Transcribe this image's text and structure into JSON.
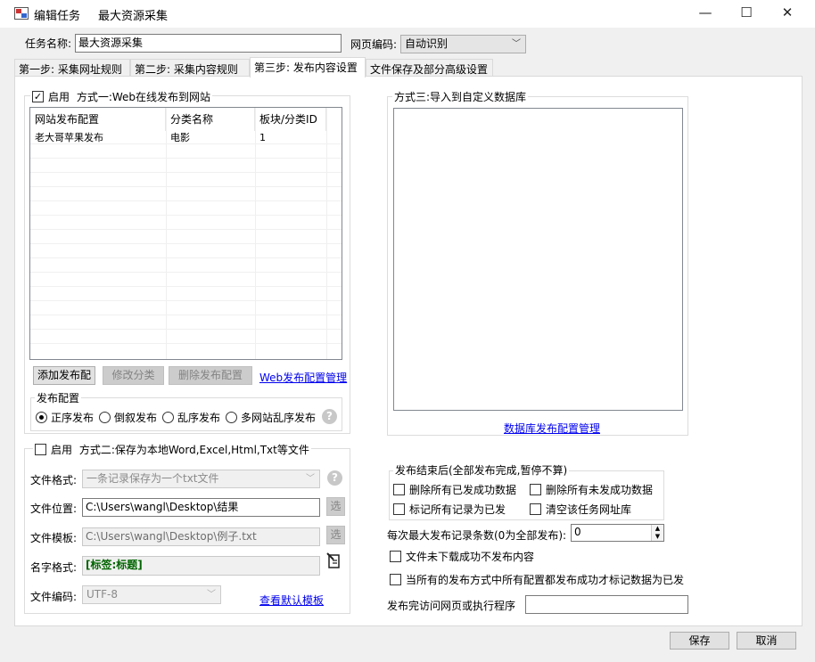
{
  "window": {
    "title": "编辑任务",
    "subtitle": "最大资源采集",
    "min_label": "—",
    "max_label": "☐",
    "close_label": "✕"
  },
  "header": {
    "task_name_label": "任务名称:",
    "task_name_value": "最大资源采集",
    "encoding_label": "网页编码:",
    "encoding_value": "自动识别"
  },
  "tabs": [
    {
      "label": "第一步: 采集网址规则"
    },
    {
      "label": "第二步: 采集内容规则"
    },
    {
      "label": "第三步: 发布内容设置"
    },
    {
      "label": "文件保存及部分高级设置"
    }
  ],
  "method1": {
    "enable_label": "启用",
    "title": "方式一:Web在线发布到网站",
    "checked": true,
    "columns": [
      "网站发布配置",
      "分类名称",
      "板块/分类ID"
    ],
    "rows": [
      [
        "老大哥苹果发布",
        "电影",
        "1"
      ]
    ],
    "add_button": "添加发布配",
    "edit_button": "修改分类",
    "delete_button": "删除发布配置",
    "manage_link": "Web发布配置管理",
    "publish_config_title": "发布配置",
    "order_options": [
      "正序发布",
      "倒叙发布",
      "乱序发布",
      "多网站乱序发布"
    ],
    "order_selected": "正序发布"
  },
  "method2": {
    "enable_label": "启用",
    "title": "方式二:保存为本地Word,Excel,Html,Txt等文件",
    "checked": false,
    "format_label": "文件格式:",
    "format_value": "一条记录保存为一个txt文件",
    "location_label": "文件位置:",
    "location_value": "C:\\Users\\wangl\\Desktop\\结果",
    "choose_label": "选",
    "template_label": "文件模板:",
    "template_value": "C:\\Users\\wangl\\Desktop\\例子.txt",
    "name_label": "名字格式:",
    "name_value": "[标签:标题]",
    "encoding_label": "文件编码:",
    "encoding_value": "UTF-8",
    "view_template_link": "查看默认模板"
  },
  "method3": {
    "title": "方式三:导入到自定义数据库",
    "manage_link": "数据库发布配置管理"
  },
  "after_publish": {
    "title": "发布结束后(全部发布完成,暂停不算)",
    "options": [
      {
        "label": "删除所有已发成功数据",
        "checked": false
      },
      {
        "label": "删除所有未发成功数据",
        "checked": false
      },
      {
        "label": "标记所有记录为已发",
        "checked": false
      },
      {
        "label": "清空该任务网址库",
        "checked": false
      }
    ]
  },
  "options": {
    "max_records_label": "每次最大发布记录条数(0为全部发布):",
    "max_records_value": "0",
    "no_publish_label": "文件未下载成功不发布内容",
    "mark_label": "当所有的发布方式中所有配置都发布成功才标记数据为已发",
    "visit_label": "发布完访问网页或执行程序",
    "visit_value": ""
  },
  "footer": {
    "save_label": "保存",
    "cancel_label": "取消"
  },
  "colors": {
    "link": "#0000ee",
    "name_format_green": "#006400"
  },
  "icons": [
    "app-icon",
    "help-icon",
    "picker-icon",
    "spin-up-icon",
    "spin-down-icon",
    "dropdown-arrow-icon"
  ]
}
